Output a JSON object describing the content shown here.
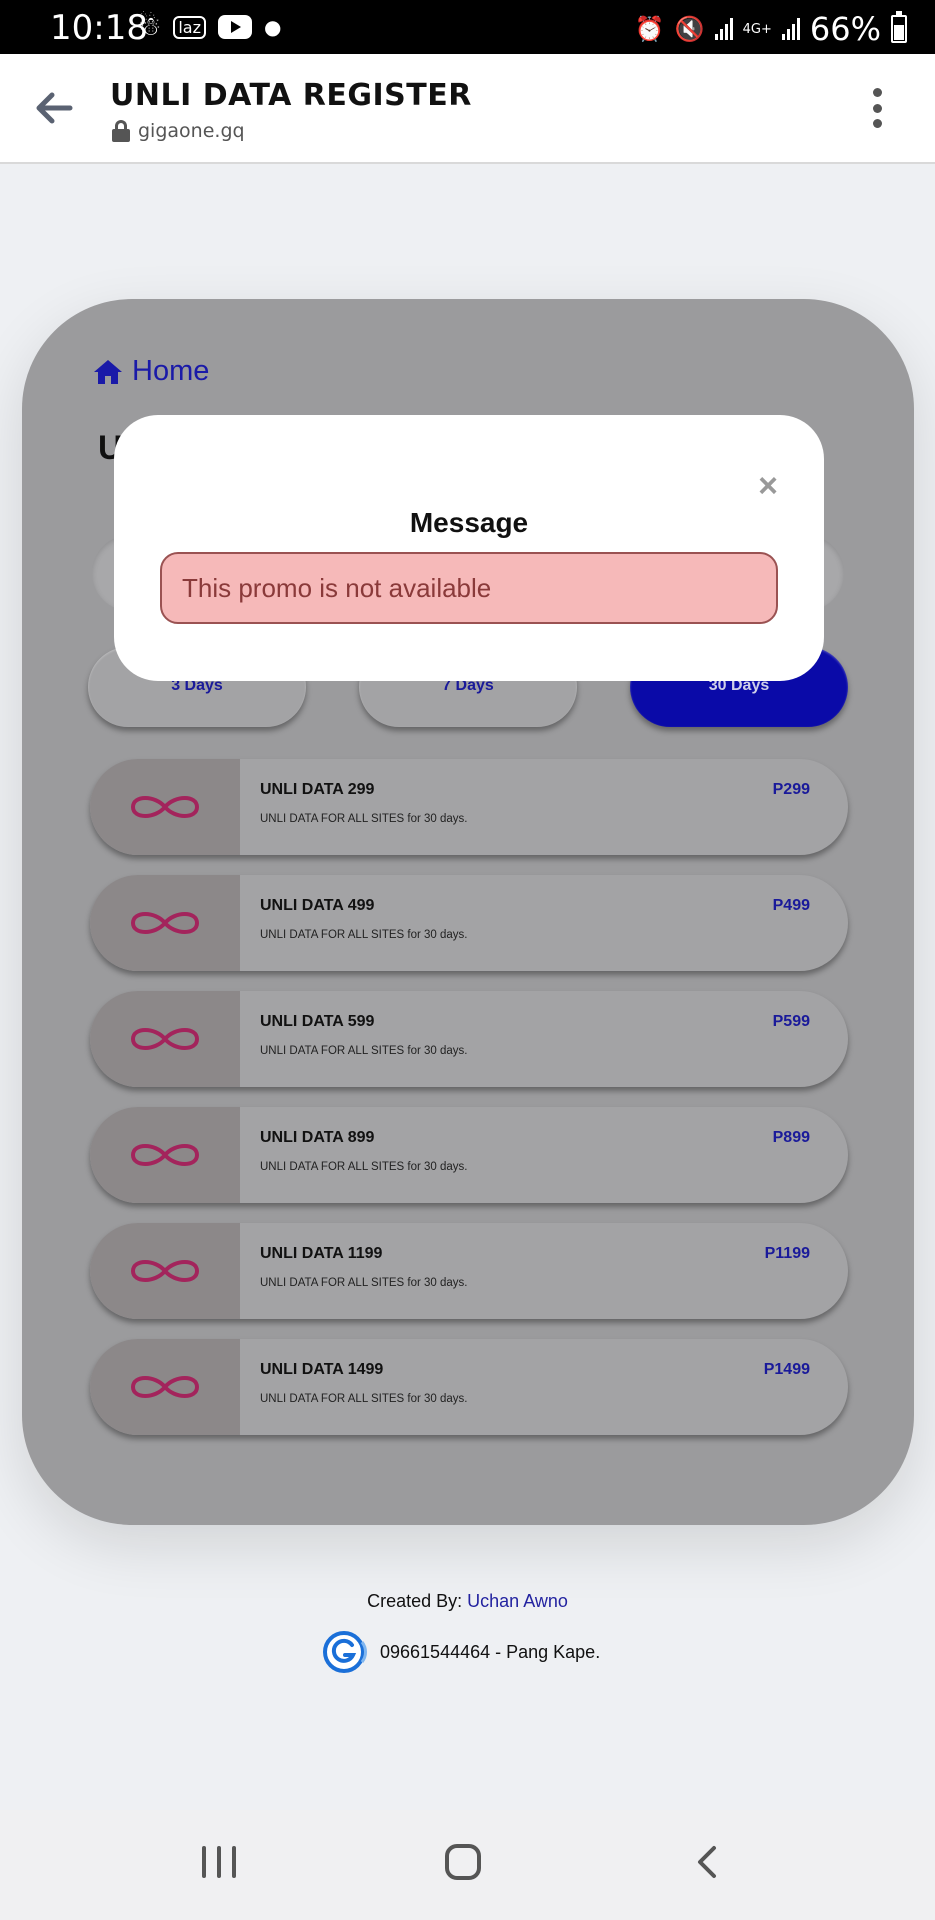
{
  "status_bar": {
    "time": "10:18",
    "left_icons": [
      "notification-icon",
      "lazada-icon",
      "youtube-icon",
      "dot-icon"
    ],
    "network_label": "4G+",
    "battery_level": "66%",
    "battery_fraction": 0.66
  },
  "browser": {
    "title": "UNLI DATA REGISTER",
    "url": "gigaone.gq"
  },
  "card": {
    "home_label": "Home",
    "heading_partial": "U",
    "tabs": [
      {
        "label": "3 Days",
        "active": false
      },
      {
        "label": "7 Days",
        "active": false
      },
      {
        "label": "30 Days",
        "active": true
      }
    ],
    "plans": [
      {
        "name": "UNLI DATA 299",
        "desc": "UNLI DATA FOR ALL SITES for 30 days.",
        "price": "P299"
      },
      {
        "name": "UNLI DATA 499",
        "desc": "UNLI DATA FOR ALL SITES for 30 days.",
        "price": "P499"
      },
      {
        "name": "UNLI DATA 599",
        "desc": "UNLI DATA FOR ALL SITES for 30 days.",
        "price": "P599"
      },
      {
        "name": "UNLI DATA 899",
        "desc": "UNLI DATA FOR ALL SITES for 30 days.",
        "price": "P899"
      },
      {
        "name": "UNLI DATA 1199",
        "desc": "UNLI DATA FOR ALL SITES for 30 days.",
        "price": "P1199"
      },
      {
        "name": "UNLI DATA 1499",
        "desc": "UNLI DATA FOR ALL SITES for 30 days.",
        "price": "P1499"
      }
    ],
    "plan_icon": "infinity-icon"
  },
  "modal": {
    "close_label": "×",
    "title": "Message",
    "alert": "This promo is not available"
  },
  "footer": {
    "created_by_label": "Created By:",
    "author": "Uchan Awno",
    "contact": "09661544464 - Pang Kape."
  },
  "colors": {
    "accent": "#0a0aa8",
    "link": "#1a1aa8",
    "infinity": "#a3245c",
    "alert_bg": "#f6b9b9",
    "alert_text": "#8a3a3a"
  }
}
